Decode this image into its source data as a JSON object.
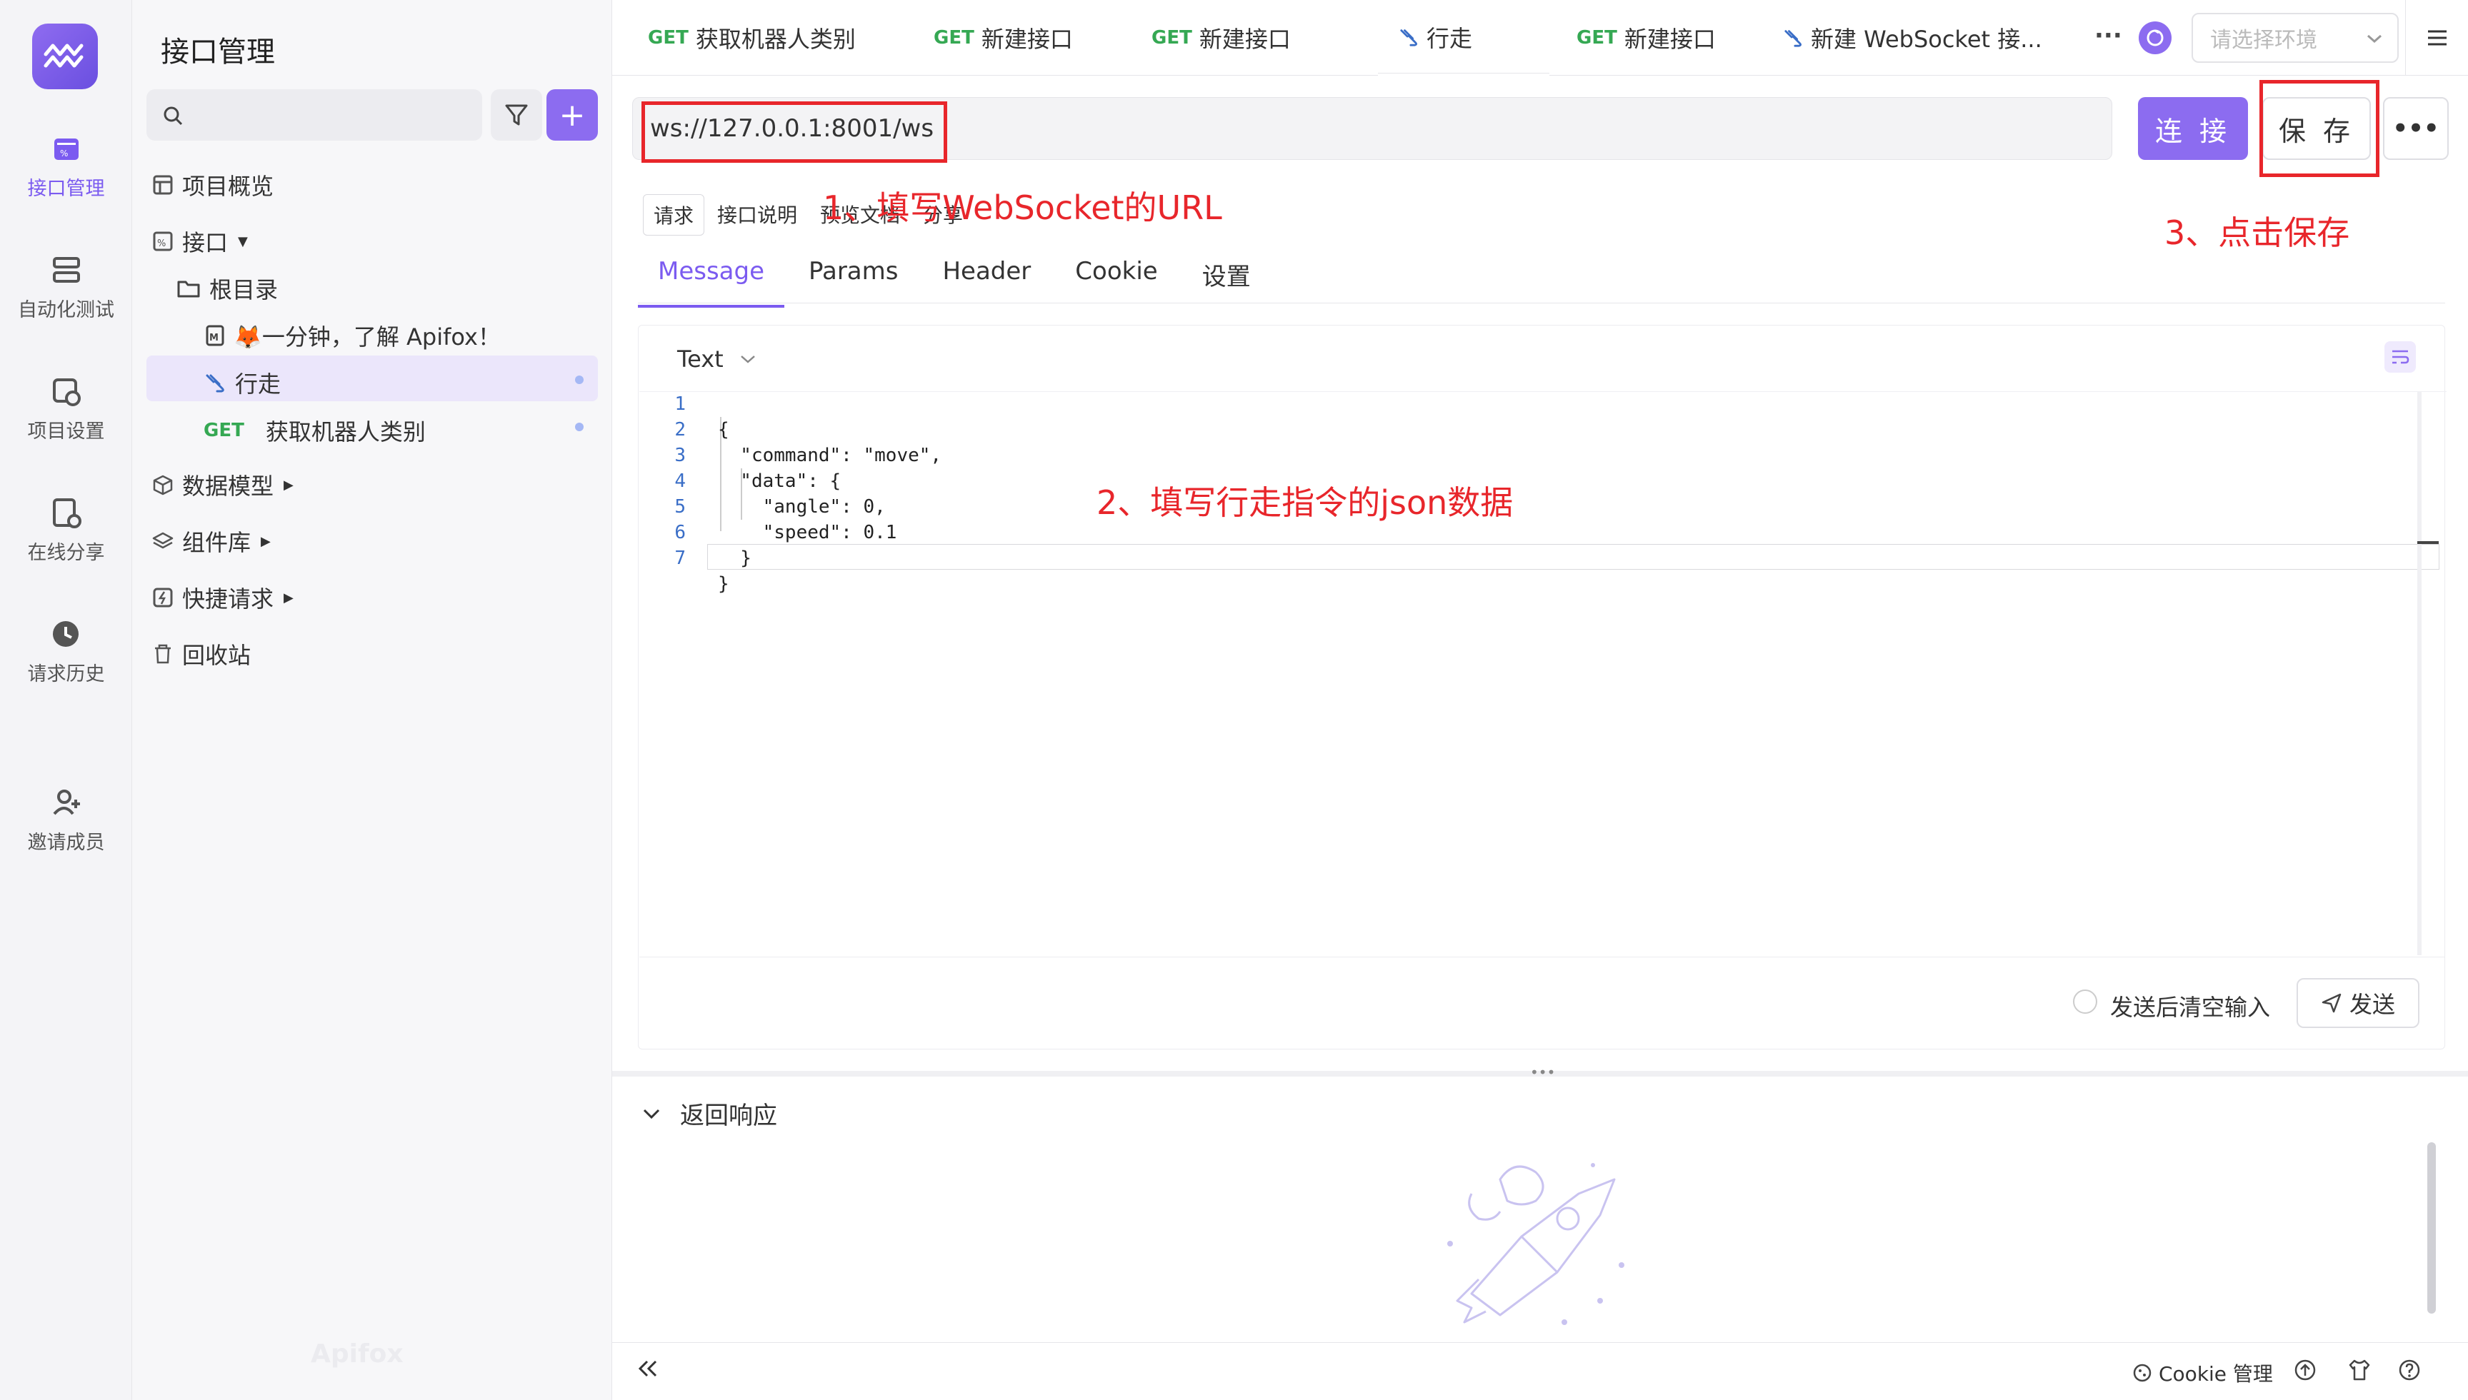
{
  "app": {
    "brand_watermark": "Apifox"
  },
  "rail": {
    "items": [
      {
        "label": "接口管理",
        "icon": "api-icon"
      },
      {
        "label": "自动化测试",
        "icon": "automation-icon"
      },
      {
        "label": "项目设置",
        "icon": "settings-icon"
      },
      {
        "label": "在线分享",
        "icon": "share-icon"
      },
      {
        "label": "请求历史",
        "icon": "history-icon"
      },
      {
        "label": "邀请成员",
        "icon": "invite-icon"
      }
    ]
  },
  "sidebar": {
    "title": "接口管理",
    "overview": "项目概览",
    "api": "接口",
    "root": "根目录",
    "intro_doc": "🦊一分钟，了解 Apifox！",
    "ws_item": "行走",
    "get_item_method": "GET",
    "get_item": "获取机器人类别",
    "data_model": "数据模型",
    "components": "组件库",
    "quick_request": "快捷请求",
    "recycle_bin": "回收站"
  },
  "tabs": [
    {
      "method": "GET",
      "label": "获取机器人类别"
    },
    {
      "method": "GET",
      "label": "新建接口"
    },
    {
      "method": "GET",
      "label": "新建接口"
    },
    {
      "method": "",
      "label": "行走"
    },
    {
      "method": "GET",
      "label": "新建接口"
    },
    {
      "method": "",
      "label": "新建 WebSocket 接..."
    }
  ],
  "tabs_more": "···",
  "env": {
    "placeholder": "请选择环境"
  },
  "request": {
    "url": "ws://127.0.0.1:8001/ws",
    "connect_label": "连 接",
    "save_label": "保 存",
    "more_label": "•••"
  },
  "subtabs": [
    "请求",
    "接口说明",
    "预览文档",
    "分享"
  ],
  "message_tabs": [
    "Message",
    "Params",
    "Header",
    "Cookie",
    "设置"
  ],
  "editor": {
    "format": "Text",
    "lines": [
      "{",
      "  \"command\": \"move\",",
      "  \"data\": {",
      "    \"angle\": 0,",
      "    \"speed\": 0.1",
      "  }",
      "}"
    ],
    "clear_after_send": "发送后清空输入",
    "send_label": "发送"
  },
  "annotations": {
    "step1": "1、填写WebSocket的URL",
    "step2": "2、填写行走指令的json数据",
    "step3": "3、点击保存"
  },
  "response": {
    "title": "返回响应"
  },
  "footer": {
    "cookie": "Cookie 管理"
  },
  "colors": {
    "accent": "#8c6cf0",
    "get": "#35a853",
    "annotation": "#e8262b"
  }
}
